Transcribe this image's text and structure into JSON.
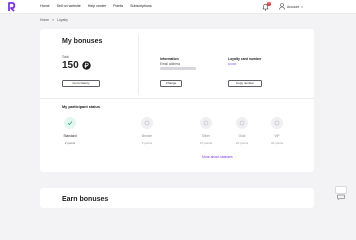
{
  "header": {
    "nav": [
      "Home",
      "Sell on website",
      "Help center",
      "Points",
      "Subscriptions"
    ],
    "notifications_count": "1",
    "user_name": "Account"
  },
  "breadcrumbs": [
    "Home",
    ">",
    "Loyalty"
  ],
  "bonuses": {
    "title": "My bonuses",
    "total_label": "Total",
    "amount": "150",
    "history_button": "Go to history"
  },
  "info": {
    "label": "Information",
    "email_hint": "Email address",
    "change_button": "Change"
  },
  "card_number": {
    "label": "Loyalty card number",
    "value": "•••••••",
    "copy_button": "Copy number"
  },
  "status": {
    "title": "My participant status",
    "current": {
      "name": "Standard",
      "points": "2 points"
    },
    "levels": [
      {
        "name": "Bronze",
        "points": "5 points"
      },
      {
        "name": "Silver",
        "points": "10 points"
      },
      {
        "name": "Gold",
        "points": "20 points"
      },
      {
        "name": "VIP",
        "points": "40 points"
      }
    ],
    "more_link": "More about statuses"
  },
  "bottom": {
    "title": "Earn bonuses"
  },
  "colors": {
    "accent": "#7a3cd8",
    "brand": "#7b2ff7",
    "badge": "#e53935"
  }
}
